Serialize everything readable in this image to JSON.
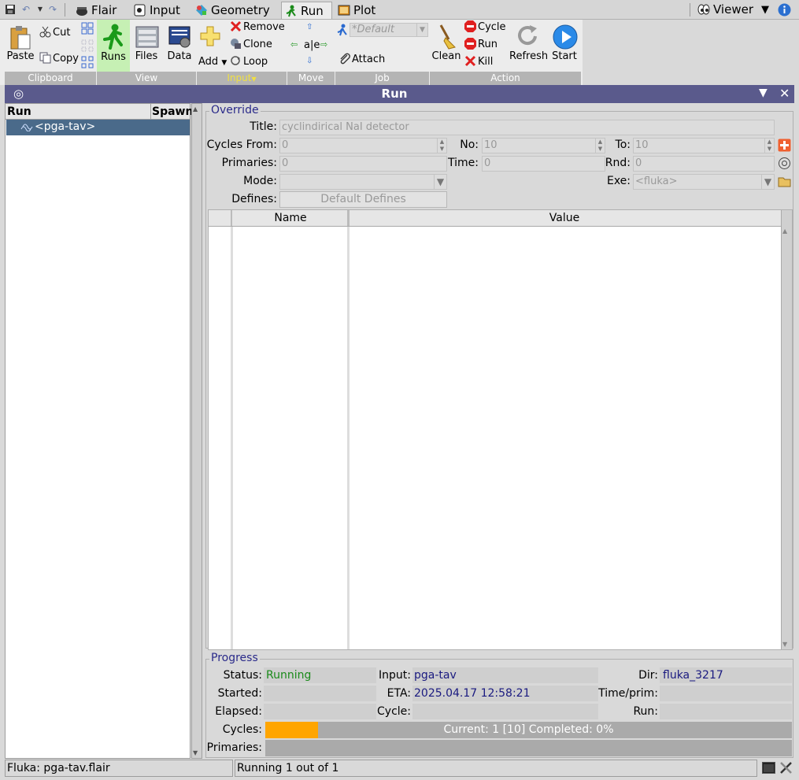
{
  "topbar": {
    "tabs": [
      {
        "label": "Flair",
        "icon": "cauldron-icon"
      },
      {
        "label": "Input",
        "icon": "card-icon"
      },
      {
        "label": "Geometry",
        "icon": "geometry-icon"
      },
      {
        "label": "Run",
        "icon": "running-man-icon"
      },
      {
        "label": "Plot",
        "icon": "plot-icon"
      }
    ],
    "active_tab": "Run",
    "viewer_label": "Viewer"
  },
  "ribbon": {
    "paste": "Paste",
    "cut": "Cut",
    "copy": "Copy",
    "runs": "Runs",
    "files": "Files",
    "data": "Data",
    "add": "Add",
    "remove": "Remove",
    "clone": "Clone",
    "loop": "Loop",
    "move_center": "a|e",
    "job_select": "*Default",
    "attach": "Attach",
    "clean": "Clean",
    "cycle": "Cycle",
    "run": "Run",
    "kill": "Kill",
    "refresh": "Refresh",
    "start": "Start",
    "groups": {
      "clipboard": "Clipboard",
      "view": "View",
      "input": "Input",
      "move": "Move",
      "job": "Job",
      "action": "Action"
    }
  },
  "run_header": {
    "title": "Run"
  },
  "run_list": {
    "col_run": "Run",
    "col_spawn": "Spawn",
    "items": [
      "<pga-tav>"
    ]
  },
  "override": {
    "group_title": "Override",
    "title_label": "Title:",
    "title_value": "cyclindirical NaI detector",
    "cycles_from_label": "Cycles From:",
    "cycles_from_value": "0",
    "no_label": "No:",
    "no_value": "10",
    "to_label": "To:",
    "to_value": "10",
    "primaries_label": "Primaries:",
    "primaries_value": "0",
    "time_label": "Time:",
    "time_value": "0",
    "rnd_label": "Rnd:",
    "rnd_value": "0",
    "mode_label": "Mode:",
    "mode_value": "",
    "exe_label": "Exe:",
    "exe_value": "<fluka>",
    "defines_label": "Defines:",
    "defines_button": "Default Defines",
    "table_col_name": "Name",
    "table_col_value": "Value"
  },
  "progress": {
    "group_title": "Progress",
    "status_label": "Status:",
    "status_value": "Running",
    "input_label": "Input:",
    "input_value": "pga-tav",
    "dir_label": "Dir:",
    "dir_value": "fluka_3217",
    "started_label": "Started:",
    "started_value": "",
    "eta_label": "ETA:",
    "eta_value": "2025.04.17 12:58:21",
    "time_prim_label": "Time/prim:",
    "time_prim_value": "",
    "elapsed_label": "Elapsed:",
    "elapsed_value": "",
    "cycle_label": "Cycle:",
    "cycle_value": "",
    "run_label": "Run:",
    "run_value": "",
    "cycles_label": "Cycles:",
    "cycles_bar_text": "Current: 1 [10] Completed: 0%",
    "cycles_fraction": 0.1,
    "primaries_label": "Primaries:",
    "primaries_fraction": 0
  },
  "statusbar": {
    "left": "Fluka: pga-tav.flair",
    "middle": "Running 1 out of 1"
  },
  "colors": {
    "header_bg": "#5a5a8c",
    "progress_fill": "#ffa500",
    "running_green": "#1a8a1a",
    "selected_row": "#4a6a8a"
  }
}
